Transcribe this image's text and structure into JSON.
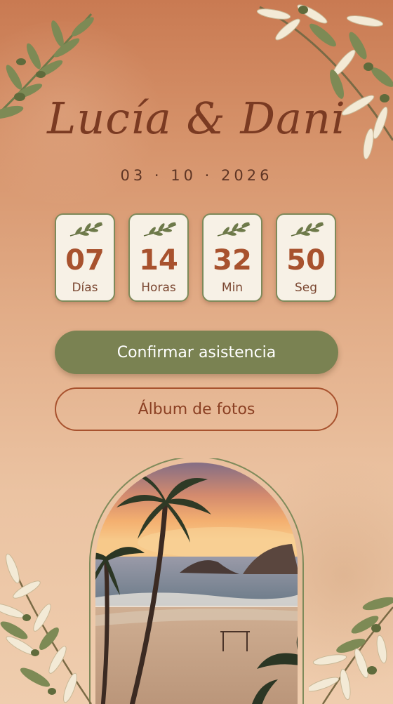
{
  "header": {
    "couple_names": "Lucía & Dani",
    "date": "03 · 10 · 2026"
  },
  "countdown": [
    {
      "value": "07",
      "unit": "Días"
    },
    {
      "value": "14",
      "unit": "Horas"
    },
    {
      "value": "32",
      "unit": "Min"
    },
    {
      "value": "50",
      "unit": "Seg"
    }
  ],
  "actions": {
    "rsvp_label": "Confirmar asistencia",
    "album_label": "Álbum de fotos"
  },
  "icons": {
    "card_ornament": "olive-sprig-icon",
    "decor": "olive-branch-icon"
  },
  "colors": {
    "title": "#7a3a22",
    "accent_green": "#7a8252",
    "accent_terracotta": "#a8522e",
    "card_bg": "#f7f1e6"
  }
}
